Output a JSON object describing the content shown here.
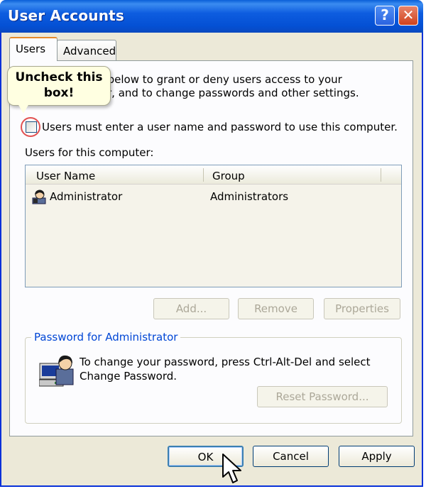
{
  "window": {
    "title": "User Accounts",
    "help_label": "?",
    "close_label": "✕"
  },
  "tabs": [
    {
      "label": "Users",
      "active": true
    },
    {
      "label": "Advanced",
      "active": false
    }
  ],
  "intro": {
    "line1": "ist below to grant or deny users access to your",
    "line2": "r, and to change passwords and other settings."
  },
  "callout": {
    "line1": "Uncheck this",
    "line2": "box!"
  },
  "checkbox": {
    "label": "Users must enter a user name and password to use this computer.",
    "checked": false
  },
  "users_section": {
    "label": "Users for this computer:",
    "columns": [
      "User Name",
      "Group"
    ],
    "rows": [
      {
        "user": "Administrator",
        "group": "Administrators",
        "icon": "user-icon"
      }
    ]
  },
  "list_buttons": {
    "add": "Add...",
    "remove": "Remove",
    "properties": "Properties"
  },
  "password_group": {
    "title": "Password for Administrator",
    "text_line1": "To change your password, press Ctrl-Alt-Del and select",
    "text_line2": "Change Password.",
    "reset_label": "Reset Password...",
    "icon": "computer-user-icon"
  },
  "dialog_buttons": {
    "ok": "OK",
    "cancel": "Cancel",
    "apply": "Apply"
  },
  "colors": {
    "titlebar": "#0a5fd8",
    "dialog_bg": "#ece9d8",
    "callout_bg": "#ffffe1",
    "highlight_ring": "#e25050",
    "groupbox_title": "#0046d5"
  }
}
